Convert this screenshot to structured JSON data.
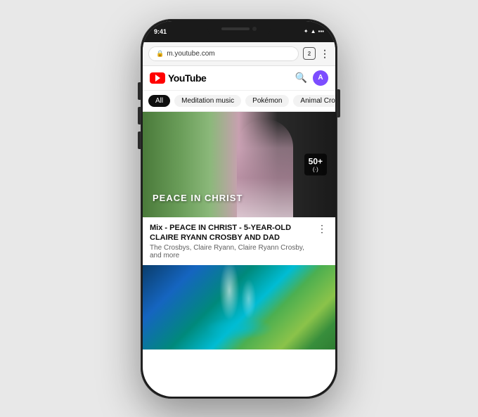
{
  "phone": {
    "status_time": "9:41",
    "url": "m.youtube.com",
    "tab_count": "2"
  },
  "youtube": {
    "logo_text": "YouTube",
    "categories": [
      "All",
      "Meditation music",
      "Pokémon",
      "Animal Cross"
    ],
    "video1": {
      "title_overlay": "PEACE IN CHRIST",
      "playlist_count": "50+",
      "playlist_icon": "(·)",
      "title": "Mix - PEACE IN CHRIST - 5-YEAR-OLD CLAIRE RYANN CROSBY AND DAD",
      "channel": "The Crosbys, Claire Ryann, Claire Ryann Crosby, and more"
    }
  },
  "icons": {
    "lock": "🔒",
    "search": "🔍",
    "menu_dots": "⋮",
    "tab_count": "2"
  }
}
